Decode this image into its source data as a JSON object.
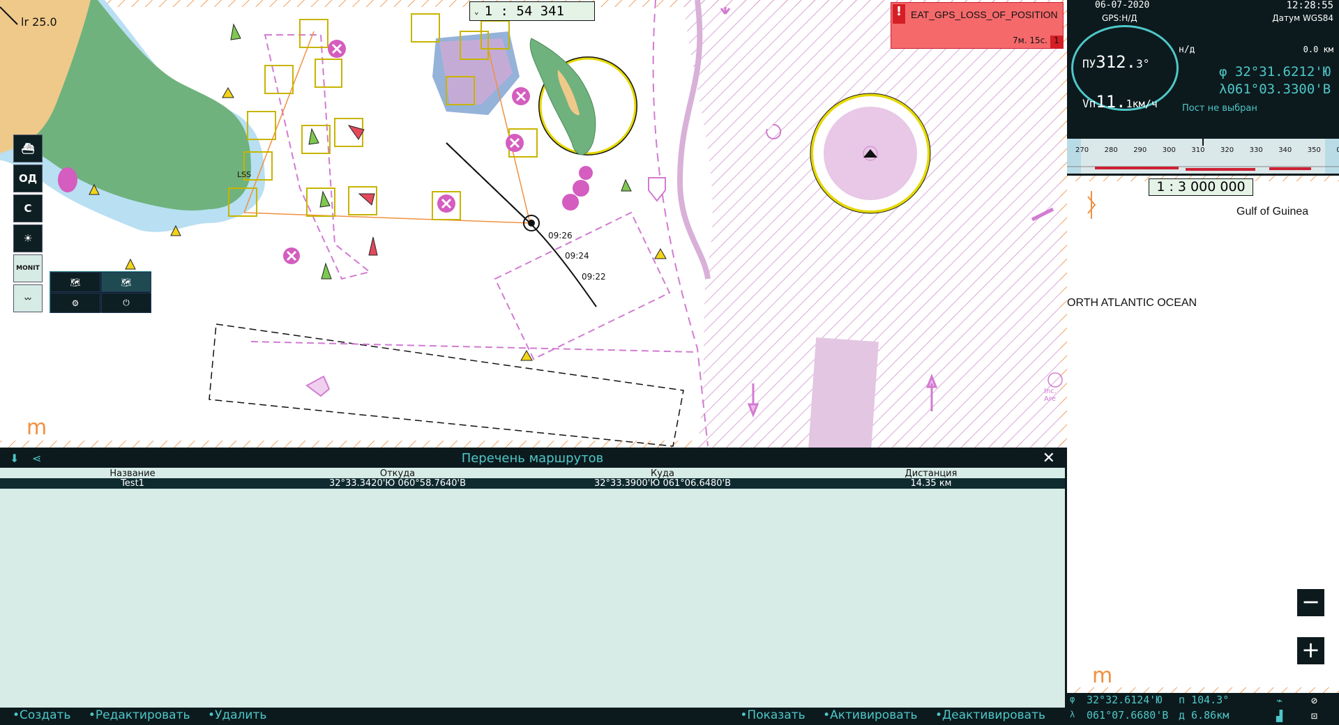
{
  "chart": {
    "scale_label": "1 :  54 341",
    "light_label": "lr 25.0",
    "label_lss": "LSS",
    "label_inc": "Inc. Are",
    "track_times": [
      "09:26",
      "09:24",
      "09:22"
    ],
    "watermark": "m"
  },
  "alert": {
    "code": "EAT_GPS_LOSS_OF_POSITION",
    "time": "7м. 15с.",
    "count": "1"
  },
  "toolbar": {
    "od": "ОД",
    "c": "С",
    "monit": "MONIT"
  },
  "routes": {
    "title": "Перечень маршрутов",
    "columns": {
      "name": "Название",
      "from": "Откуда",
      "to": "Куда",
      "distance": "Дистанция"
    },
    "rows": [
      {
        "name": "Test1",
        "from": "32°33.3420'Ю  060°58.7640'В",
        "to": "32°33.3900'Ю  061°06.6480'В",
        "distance": "14.35 км"
      }
    ]
  },
  "bottom": {
    "create": "Создать",
    "edit": "Редактировать",
    "delete": "Удалить",
    "show": "Показать",
    "activate": "Активировать",
    "deactivate": "Деактивировать"
  },
  "nav": {
    "date": "06-07-2020",
    "time": "12:28:55",
    "gps": "GPS:Н/Д",
    "datum": "Датум WGS84",
    "heading_label": "ПУ",
    "heading_int": "312.",
    "heading_frac": "3°",
    "speed_label": "Vп",
    "speed_int": "11.",
    "speed_frac": "1км/ч",
    "nd": "н/д",
    "range": "0.0 км",
    "lat": "φ 32°31.6212'Ю",
    "lon": "λ061°03.3300'В",
    "post": "Пост не выбран"
  },
  "ruler": {
    "ticks": [
      "270",
      "280",
      "290",
      "300",
      "310",
      "320",
      "330",
      "340",
      "350",
      "0"
    ]
  },
  "minimap": {
    "scale": "1 : 3 000 000",
    "gulf": "Gulf of Guinea",
    "ocean": "ORTH ATLANTIC OCEAN",
    "watermark": "m",
    "zoom_out": "−",
    "zoom_in": "+"
  },
  "cursor": {
    "lat_prefix": "φ",
    "lat": "32°32.6124'Ю",
    "lon_prefix": "λ",
    "lon": "061°07.6680'В",
    "bearing": "п 104.3°",
    "dist": "д 6.86км"
  }
}
